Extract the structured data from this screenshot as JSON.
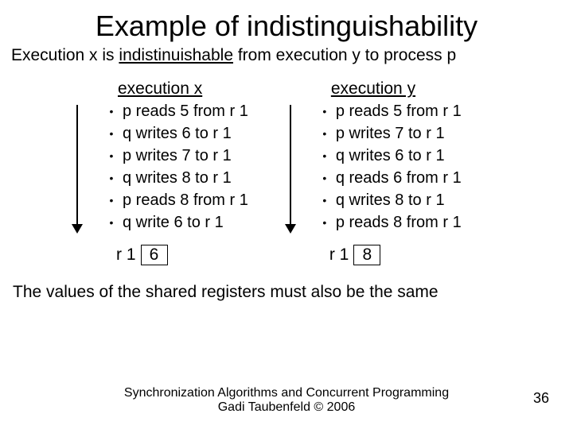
{
  "title": "Example of indistinguishability",
  "subtitle_pre": "Execution x is ",
  "subtitle_underlined": "indistinuishable",
  "subtitle_post": " from execution  y to process p",
  "execX": {
    "header": "execution x",
    "steps": [
      "p reads 5 from r 1",
      "q writes 6 to r 1",
      "p writes 7 to r 1",
      "q writes 8 to r 1",
      "p reads 8 from r 1",
      "q write 6 to r 1"
    ],
    "reg_label": "r 1",
    "reg_value": "6"
  },
  "execY": {
    "header": "execution y",
    "steps": [
      "p reads 5 from r 1",
      "p writes 7 to r 1",
      "q writes 6 to r 1",
      "q reads 6 from r 1",
      "q writes 8 to r 1",
      "p reads 8 from r 1"
    ],
    "reg_label": "r 1",
    "reg_value": "8"
  },
  "note": "The values of the shared registers must also be the same",
  "footer_line1": "Synchronization Algorithms and Concurrent Programming",
  "footer_line2": "Gadi Taubenfeld © 2006",
  "page_number": "36"
}
